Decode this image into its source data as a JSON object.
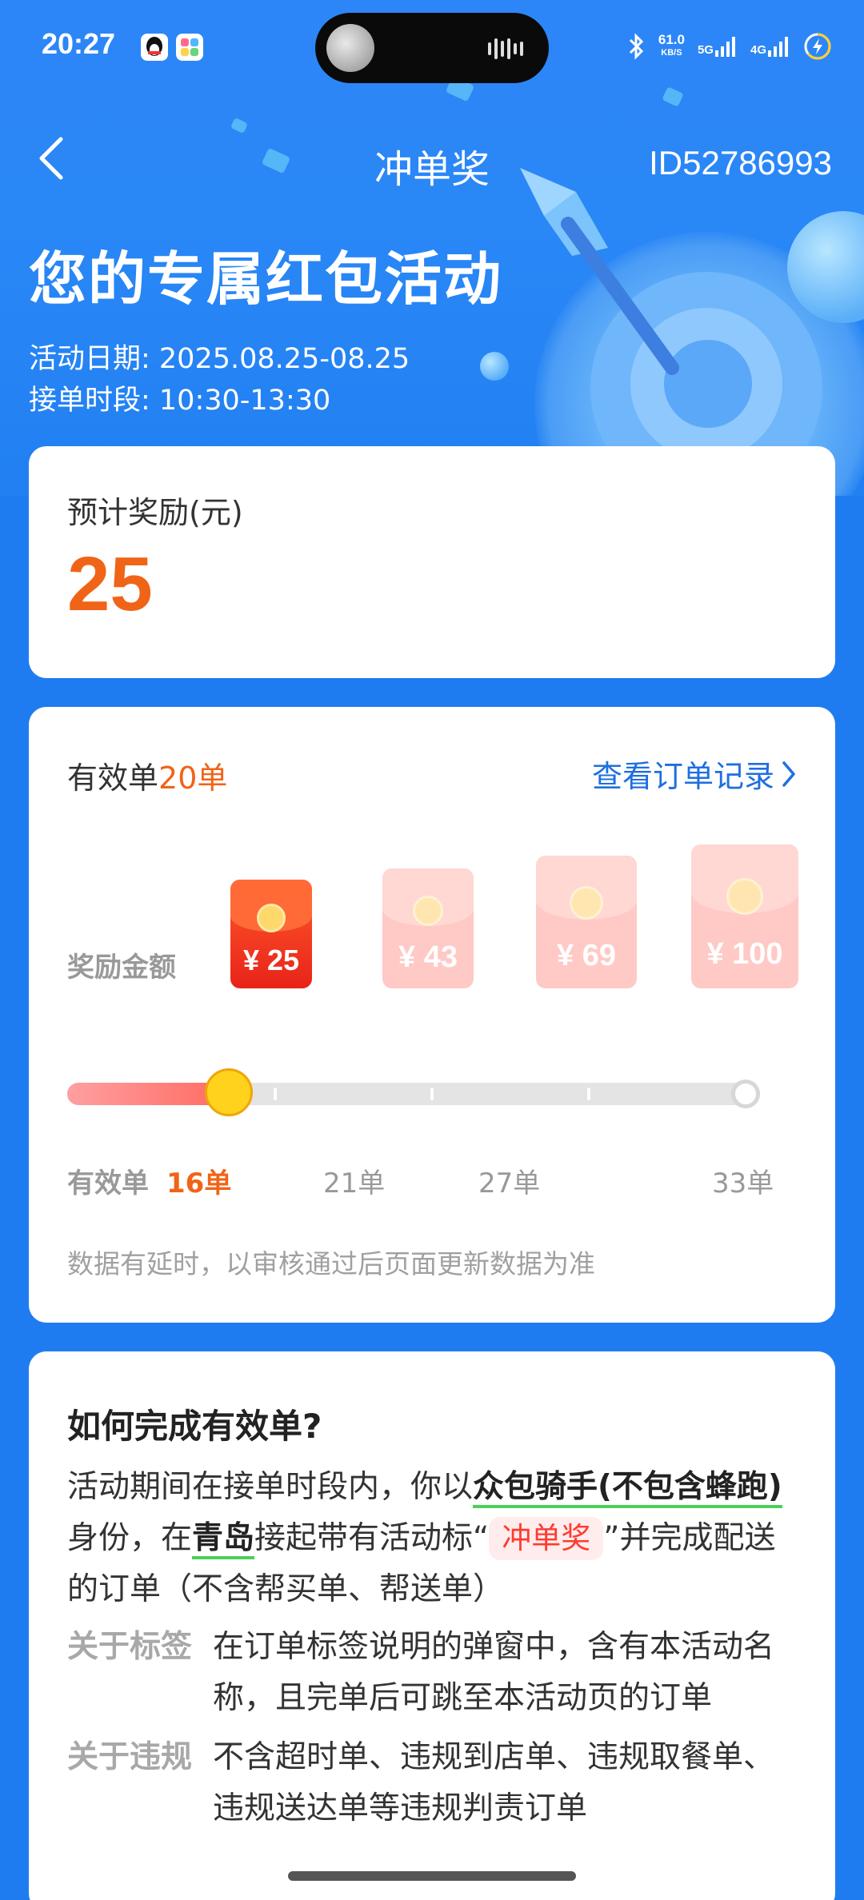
{
  "status_bar": {
    "time": "20:27",
    "net_speed_value": "61.0",
    "net_speed_unit": "KB/S",
    "signal1": "5G",
    "signal2": "4G"
  },
  "nav": {
    "title": "冲单奖",
    "id_text": "ID52786993"
  },
  "hero": {
    "title": "您的专属红包活动",
    "date_line": "活动日期: 2025.08.25-08.25",
    "time_line": "接单时段: 10:30-13:30"
  },
  "reward_card": {
    "label": "预计奖励(元)",
    "value": "25"
  },
  "progress_card": {
    "valid_prefix": "有效单",
    "valid_count": "20单",
    "view_record": "查看订单记录",
    "reward_row_label": "奖励金额",
    "rewards": [
      {
        "amount": "¥ 25",
        "active": true
      },
      {
        "amount": "¥ 43",
        "active": false
      },
      {
        "amount": "¥ 69",
        "active": false
      },
      {
        "amount": "¥ 100",
        "active": false
      }
    ],
    "progress_fraction": 0.235,
    "scale_first": "有效单",
    "scale": [
      "16单",
      "21单",
      "27单",
      "33单"
    ],
    "note": "数据有延时，以审核通过后页面更新数据为准"
  },
  "rules_card": {
    "title": "如何完成有效单?",
    "p1_a": "活动期间在接单时段内，你以",
    "p1_em1": "众包骑手(不包含蜂跑)",
    "p1_b": "身份，在",
    "p1_em2": "青岛",
    "p1_c": "接起带有活动标“",
    "p1_tag": "冲单奖",
    "p1_d": "”并完成配送的订单（不含帮买单、帮送单）",
    "items": [
      {
        "key": "关于标签",
        "value": "在订单标签说明的弹窗中，含有本活动名称，且完单后可跳至本活动页的订单"
      },
      {
        "key": "关于违规",
        "value": "不含超时单、违规到店单、违规取餐单、违规送达单等违规判责订单"
      }
    ]
  },
  "colors": {
    "primary_blue": "#1f7cf0",
    "accent_orange": "#f06418",
    "link_blue": "#1f6fe0",
    "tag_red": "#ff3b30"
  }
}
